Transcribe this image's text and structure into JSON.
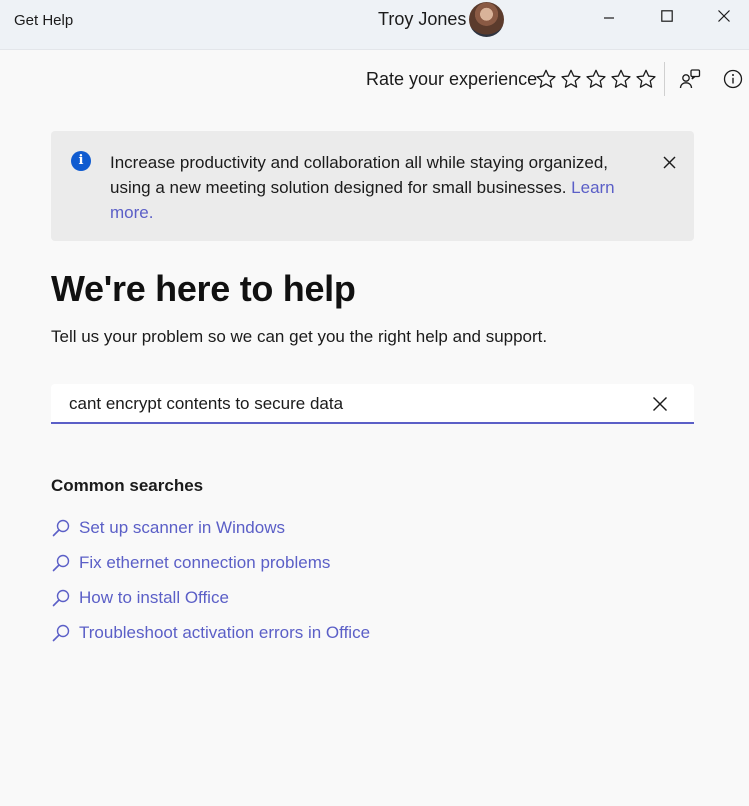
{
  "window": {
    "app_title": "Get Help",
    "user_name": "Troy Jones",
    "controls": [
      "minimize-icon",
      "maximize-icon",
      "close-icon"
    ]
  },
  "rating": {
    "label": "Rate your experience",
    "stars": 5,
    "selected": 0
  },
  "toolbar": {
    "icons": [
      "contact-support-icon",
      "info-icon"
    ]
  },
  "banner": {
    "text": "Increase productivity and collaboration all while staying organized, using a new meeting solution designed for small businesses. ",
    "link_text": "Learn more."
  },
  "main": {
    "title": "We're here to help",
    "subtitle": "Tell us your problem so we can get you the right help and support."
  },
  "search": {
    "value": "cant encrypt contents to secure data",
    "placeholder": ""
  },
  "common_searches": {
    "title": "Common searches",
    "items": [
      "Set up scanner in Windows",
      "Fix ethernet connection problems",
      "How to install Office",
      "Troubleshoot activation errors in Office"
    ]
  },
  "colors": {
    "accent": "#5b5fc7",
    "info_blue": "#0f5bd0",
    "titlebar_bg": "#eef2f6",
    "banner_bg": "#ebebeb",
    "page_bg": "#f9f9f9"
  }
}
